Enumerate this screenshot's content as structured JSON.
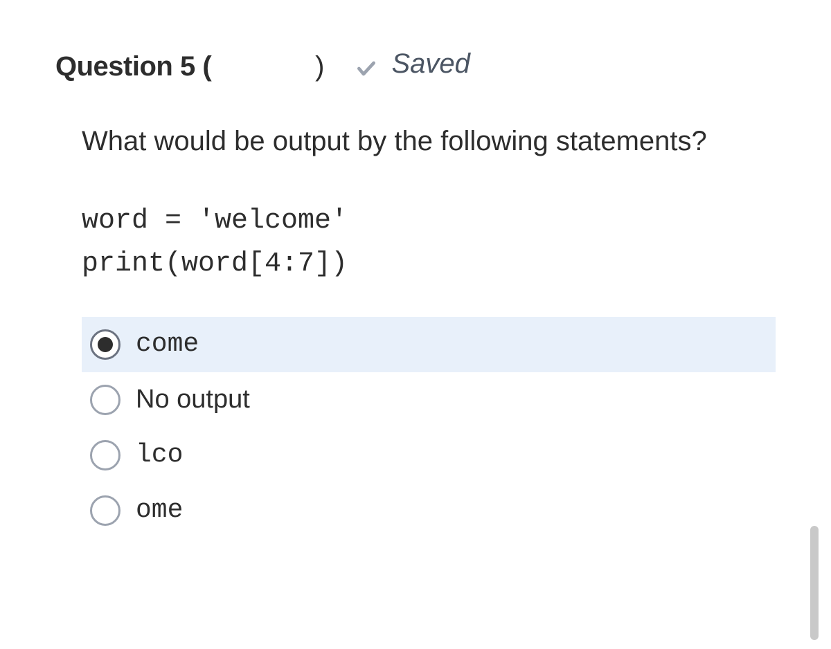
{
  "header": {
    "question_label": "Question 5 (",
    "closing": ")",
    "saved_text": "Saved"
  },
  "prompt": "What would be output by the following statements?",
  "code": "word = 'welcome'\nprint(word[4:7])",
  "options": [
    {
      "label": "come",
      "mono": true,
      "selected": true
    },
    {
      "label": "No output",
      "mono": false,
      "selected": false
    },
    {
      "label": "lco",
      "mono": true,
      "selected": false
    },
    {
      "label": "ome",
      "mono": true,
      "selected": false
    }
  ]
}
